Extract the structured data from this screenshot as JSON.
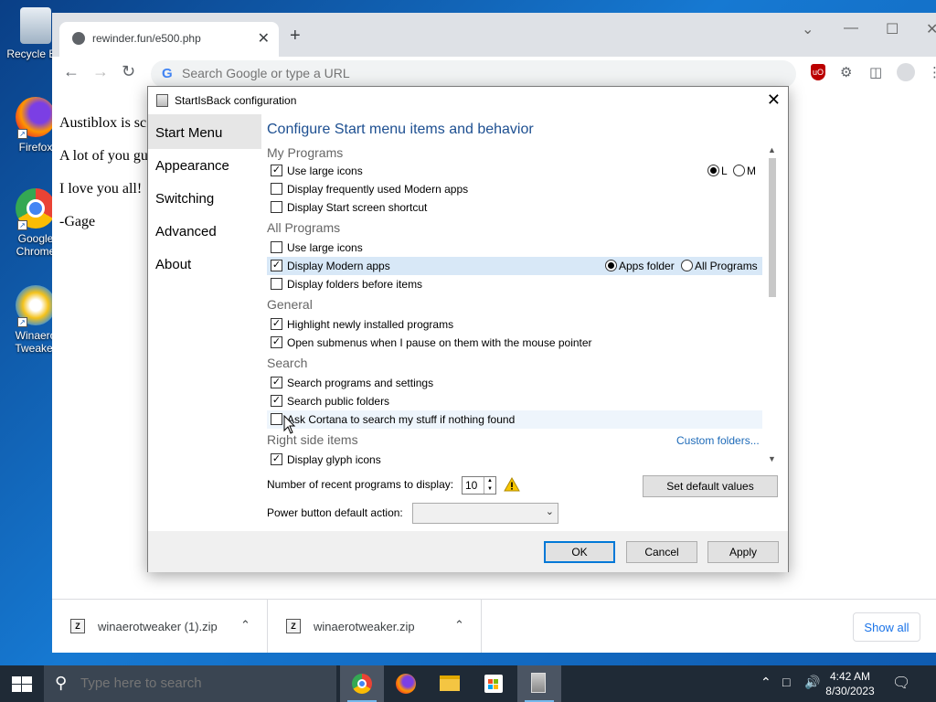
{
  "desktop": {
    "icons": [
      {
        "label": "Recycle Bin"
      },
      {
        "label": "Firefox"
      },
      {
        "label": "Google Chrome"
      },
      {
        "label": "Winaero Tweaker"
      }
    ]
  },
  "browser": {
    "tab_title": "rewinder.fun/e500.php",
    "omnibox_placeholder": "Search Google or type a URL",
    "page_lines": [
      "Austiblox is sc",
      "A lot of you gu",
      "I love you all!",
      "-Gage"
    ],
    "downloads": [
      {
        "name": "winaerotweaker (1).zip"
      },
      {
        "name": "winaerotweaker.zip"
      }
    ],
    "show_all_label": "Show all"
  },
  "dialog": {
    "title": "StartIsBack configuration",
    "nav": [
      "Start Menu",
      "Appearance",
      "Switching",
      "Advanced",
      "About"
    ],
    "heading": "Configure Start menu items and behavior",
    "sections": {
      "my_programs": "My Programs",
      "all_programs": "All Programs",
      "general": "General",
      "search": "Search",
      "right_side": "Right side items"
    },
    "options": {
      "mp_large_icons": "Use large icons",
      "mp_freq_modern": "Display frequently used Modern apps",
      "mp_start_shortcut": "Display Start screen shortcut",
      "ap_large_icons": "Use large icons",
      "ap_modern_apps": "Display Modern apps",
      "ap_folders_first": "Display folders before items",
      "g_highlight": "Highlight newly installed programs",
      "g_submenus": "Open submenus when I pause on them with the mouse pointer",
      "s_programs": "Search programs and settings",
      "s_public": "Search public folders",
      "s_cortana": "Ask Cortana to search my stuff if nothing found",
      "r_glyph": "Display glyph icons"
    },
    "icon_size_options": [
      "L",
      "M"
    ],
    "modern_apps_options": [
      "Apps folder",
      "All Programs"
    ],
    "custom_folders_link": "Custom folders...",
    "recent_label": "Number of recent programs to display:",
    "recent_value": "10",
    "set_default_label": "Set default values",
    "power_label": "Power button default action:",
    "power_value": "",
    "ok_label": "OK",
    "cancel_label": "Cancel",
    "apply_label": "Apply"
  },
  "taskbar": {
    "search_placeholder": "Type here to search",
    "time": "4:42 AM",
    "date": "8/30/2023"
  }
}
